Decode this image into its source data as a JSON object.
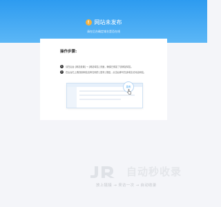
{
  "banner": {
    "icon": "warning-icon",
    "icon_glyph": "!",
    "title": "网站未发布",
    "subtitle": "请在后台确定域名是否在线"
  },
  "steps": {
    "title": "操作步骤:",
    "items": [
      {
        "num": "1",
        "text": "请在后台 [网站设置] → [网站域名] 页面，确保已绑定了该网站域名。"
      },
      {
        "num": "2",
        "text": "在后台右上角找到网站名称右侧的 [发布] 按钮，点击后即可在该域名访问此网站。"
      }
    ],
    "illustration": {
      "bubble_label": "发布",
      "cursor_icon": "hand-pointer-icon"
    }
  },
  "watermark": {
    "logo": "jr-logo-icon",
    "title": "自动秒收录",
    "slogan": "放上链接 → 来访一次 → 自动收录"
  },
  "colors": {
    "banner_top": "#2d9bf0",
    "banner_bottom": "#5cb7f6",
    "warning": "#f5b13d",
    "background": "#f4f5f9"
  }
}
